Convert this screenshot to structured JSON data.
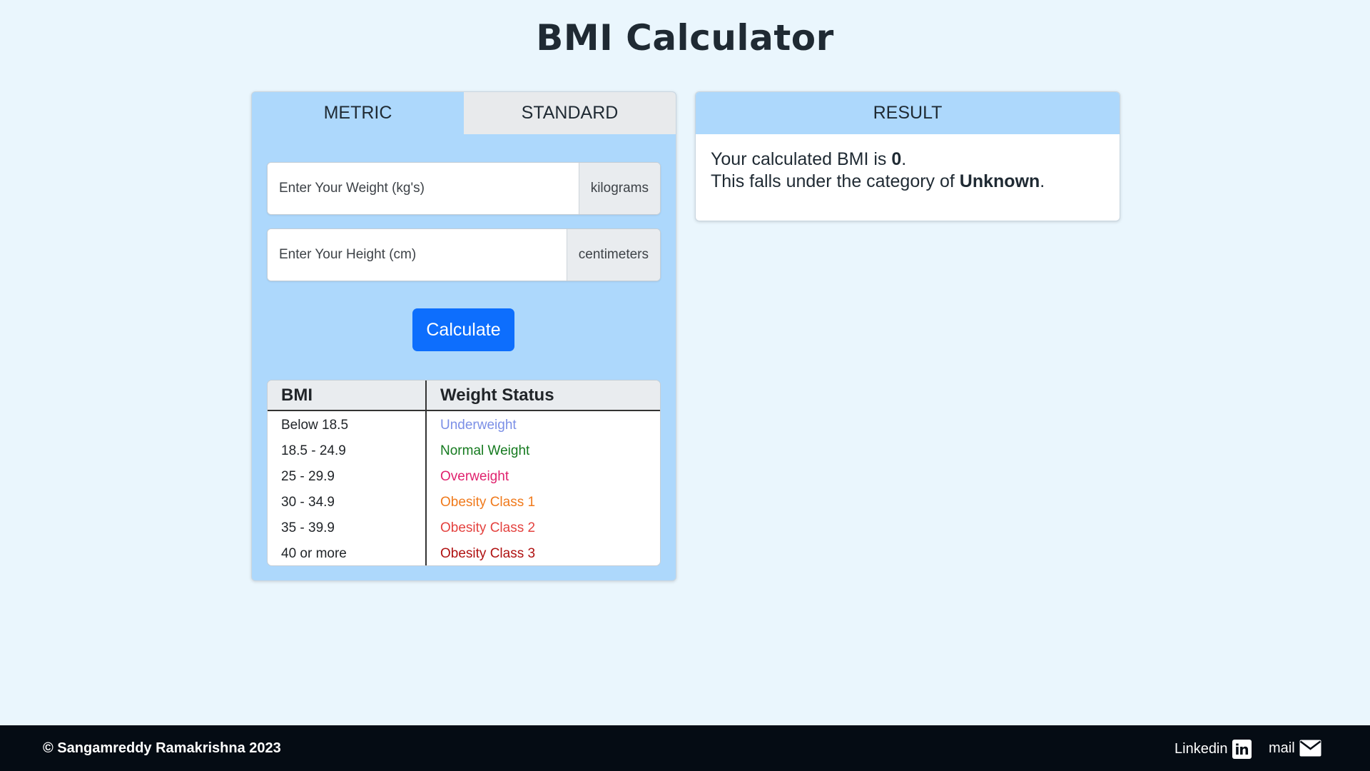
{
  "page": {
    "title": "BMI Calculator"
  },
  "tabs": [
    {
      "label": "METRIC",
      "active": true
    },
    {
      "label": "STANDARD",
      "active": false
    }
  ],
  "inputs": {
    "weight": {
      "value": "",
      "placeholder": "Enter Your Weight (kg's)",
      "unit": "kilograms"
    },
    "height": {
      "value": "",
      "placeholder": "Enter Your Height (cm)",
      "unit": "centimeters"
    }
  },
  "calculate_label": "Calculate",
  "bmi_table": {
    "headers": [
      "BMI",
      "Weight Status"
    ],
    "rows": [
      {
        "range": "Below 18.5",
        "status": "Underweight",
        "color": "#7b8fe6"
      },
      {
        "range": "18.5 - 24.9",
        "status": "Normal Weight",
        "color": "#157a1f"
      },
      {
        "range": "25 - 29.9",
        "status": "Overweight",
        "color": "#e0226e"
      },
      {
        "range": "30 - 34.9",
        "status": "Obesity Class 1",
        "color": "#f07a1c"
      },
      {
        "range": "35 - 39.9",
        "status": "Obesity Class 2",
        "color": "#e4423f"
      },
      {
        "range": "40 or more",
        "status": "Obesity Class 3",
        "color": "#b01212"
      }
    ]
  },
  "result": {
    "header": "RESULT",
    "line1_prefix": "Your calculated BMI is ",
    "bmi_value": "0",
    "line1_suffix": ".",
    "line2_prefix": "This falls under the category of ",
    "category": "Unknown",
    "line2_suffix": "."
  },
  "footer": {
    "copyright": "© Sangamreddy Ramakrishna 2023",
    "linkedin_label": "Linkedin",
    "linkedin_icon": "linkedin-icon",
    "mail_label": "mail",
    "mail_icon": "envelope-icon"
  },
  "colors": {
    "page_background": "#eaf6fd",
    "card_accent": "#add8fc",
    "button_primary": "#0d6efd",
    "footer_background": "#050c14"
  }
}
